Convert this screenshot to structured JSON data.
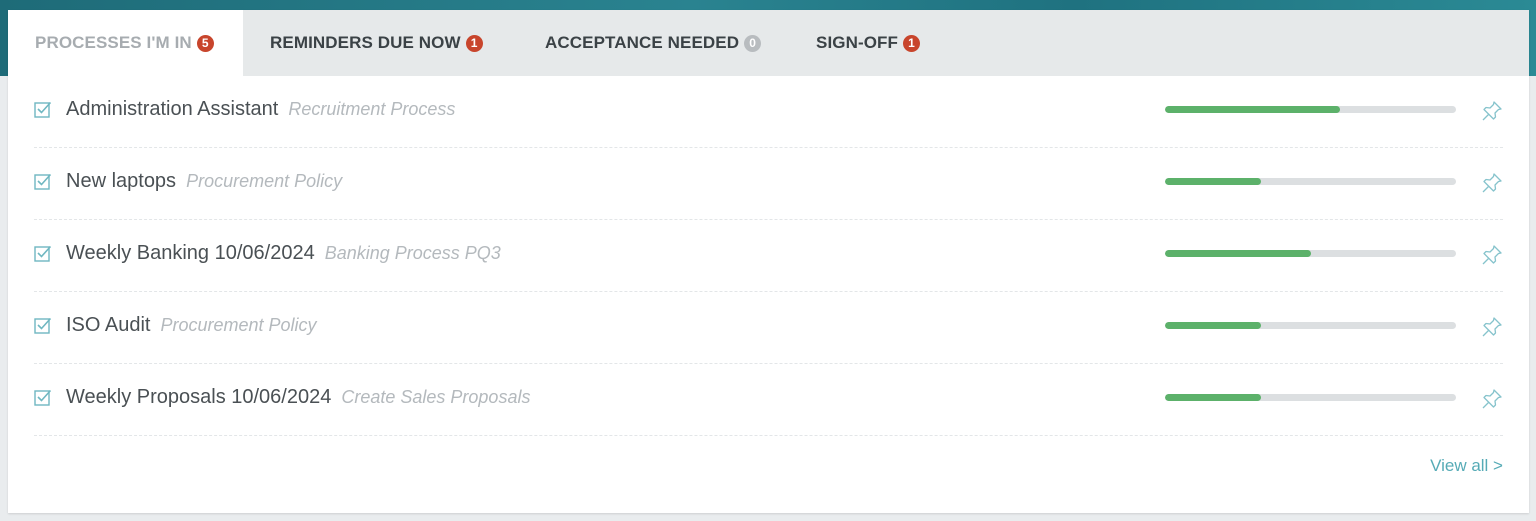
{
  "colors": {
    "accent": "#56abb6",
    "badge_red": "#c8452c",
    "badge_grey": "#b8bcbf",
    "progress_green": "#5cb16a",
    "progress_track": "#dcdfe1"
  },
  "tabs": [
    {
      "label": "PROCESSES I'M IN",
      "count": "5",
      "active": true
    },
    {
      "label": "REMINDERS DUE NOW",
      "count": "1",
      "active": false
    },
    {
      "label": "ACCEPTANCE NEEDED",
      "count": "0",
      "active": false
    },
    {
      "label": "SIGN-OFF",
      "count": "1",
      "active": false
    }
  ],
  "items": [
    {
      "title": "Administration Assistant",
      "subtitle": "Recruitment Process",
      "progress": 0.6,
      "icon": "checkbox-icon",
      "pin_icon": "pin-icon"
    },
    {
      "title": "New laptops",
      "subtitle": "Procurement Policy",
      "progress": 0.33,
      "icon": "checkbox-icon",
      "pin_icon": "pin-icon"
    },
    {
      "title": "Weekly Banking 10/06/2024",
      "subtitle": "Banking Process PQ3",
      "progress": 0.5,
      "icon": "checkbox-icon",
      "pin_icon": "pin-icon"
    },
    {
      "title": "ISO Audit",
      "subtitle": "Procurement Policy",
      "progress": 0.33,
      "icon": "checkbox-icon",
      "pin_icon": "pin-icon"
    },
    {
      "title": "Weekly Proposals 10/06/2024",
      "subtitle": "Create Sales Proposals",
      "progress": 0.33,
      "icon": "checkbox-icon",
      "pin_icon": "pin-icon"
    }
  ],
  "footer": {
    "view_all": "View all >"
  }
}
